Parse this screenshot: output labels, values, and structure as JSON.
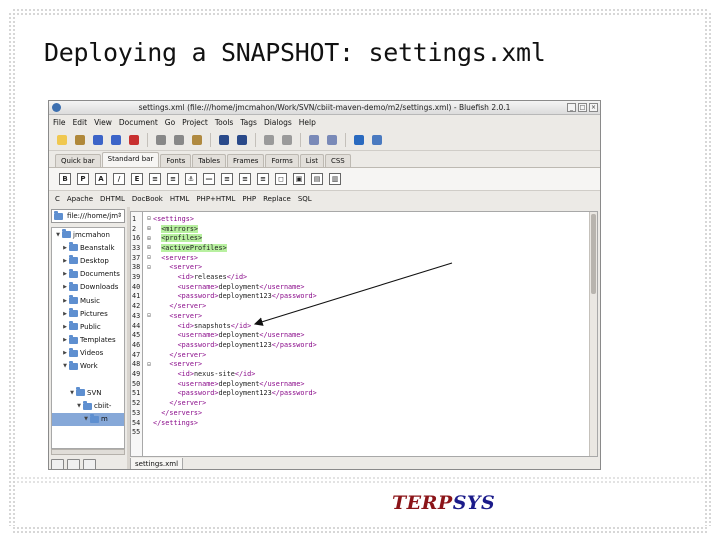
{
  "slide": {
    "title": "Deploying a SNAPSHOT: settings.xml",
    "logo_text_1": "TERP",
    "logo_text_2": "SYS"
  },
  "window": {
    "title": "settings.xml (file:///home/jmcmahon/Work/SVN/cbiit-maven-demo/m2/settings.xml) - Bluefish 2.0.1",
    "min_glyph": "_",
    "max_glyph": "□",
    "close_glyph": "×"
  },
  "menu": [
    "File",
    "Edit",
    "View",
    "Document",
    "Go",
    "Project",
    "Tools",
    "Tags",
    "Dialogs",
    "Help"
  ],
  "toolbar_icons": [
    "new-document",
    "open",
    "save",
    "save-as",
    "close",
    "cut",
    "copy",
    "paste",
    "find",
    "replace",
    "undo",
    "redo",
    "indent",
    "unindent",
    "preview",
    "settings"
  ],
  "tabs": [
    "Quick bar",
    "Standard bar",
    "Fonts",
    "Tables",
    "Frames",
    "Forms",
    "List",
    "CSS"
  ],
  "active_tab": "Standard bar",
  "standard_icons": [
    "B",
    "P",
    "A",
    "/",
    "E",
    "≡",
    "≡",
    "⚓",
    "—",
    "≡",
    "≡",
    "≡",
    "◻",
    "▣",
    "▤",
    "▥"
  ],
  "lang_menu": [
    "C",
    "Apache",
    "DHTML",
    "DocBook",
    "HTML",
    "PHP+HTML",
    "PHP",
    "Replace",
    "SQL"
  ],
  "sidebar": {
    "path": "file:///home/jm",
    "tree": [
      {
        "label": "jmcmahon",
        "level": 0,
        "twisty": "▼",
        "selected": false
      },
      {
        "label": "Beanstalk",
        "level": 1,
        "twisty": "▶",
        "selected": false
      },
      {
        "label": "Desktop",
        "level": 1,
        "twisty": "▶",
        "selected": false
      },
      {
        "label": "Documents",
        "level": 1,
        "twisty": "▶",
        "selected": false
      },
      {
        "label": "Downloads",
        "level": 1,
        "twisty": "▶",
        "selected": false
      },
      {
        "label": "Music",
        "level": 1,
        "twisty": "▶",
        "selected": false
      },
      {
        "label": "Pictures",
        "level": 1,
        "twisty": "▶",
        "selected": false
      },
      {
        "label": "Public",
        "level": 1,
        "twisty": "▶",
        "selected": false
      },
      {
        "label": "Templates",
        "level": 1,
        "twisty": "▶",
        "selected": false
      },
      {
        "label": "Videos",
        "level": 1,
        "twisty": "▶",
        "selected": false
      },
      {
        "label": "Work",
        "level": 1,
        "twisty": "▼",
        "selected": false
      },
      {
        "label": "",
        "level": 2,
        "twisty": "",
        "selected": false
      },
      {
        "label": "SVN",
        "level": 2,
        "twisty": "▼",
        "selected": false
      },
      {
        "label": "cbiit-",
        "level": 3,
        "twisty": "▼",
        "selected": false
      },
      {
        "label": "m",
        "level": 4,
        "twisty": "▼",
        "selected": true
      }
    ]
  },
  "editor": {
    "doc_tab": "settings.xml",
    "lines": [
      {
        "n": "1",
        "f": "⊟",
        "segs": [
          {
            "t": "<settings>",
            "c": "tag"
          }
        ]
      },
      {
        "n": "2",
        "f": "⊞",
        "segs": [
          {
            "t": "  "
          },
          {
            "t": "<mirrors>",
            "c": "hl"
          }
        ]
      },
      {
        "n": "16",
        "f": "⊞",
        "segs": [
          {
            "t": "  "
          },
          {
            "t": "<profiles>",
            "c": "hl"
          }
        ]
      },
      {
        "n": "33",
        "f": "⊞",
        "segs": [
          {
            "t": "  "
          },
          {
            "t": "<activeProfiles>",
            "c": "hl"
          }
        ]
      },
      {
        "n": "37",
        "f": "⊟",
        "segs": [
          {
            "t": "  "
          },
          {
            "t": "<servers>",
            "c": "tag"
          }
        ]
      },
      {
        "n": "38",
        "f": "⊟",
        "segs": [
          {
            "t": "    "
          },
          {
            "t": "<server>",
            "c": "tag"
          }
        ]
      },
      {
        "n": "39",
        "f": "",
        "segs": [
          {
            "t": "      "
          },
          {
            "t": "<id>",
            "c": "tag"
          },
          {
            "t": "releases"
          },
          {
            "t": "</id>",
            "c": "tag"
          }
        ]
      },
      {
        "n": "40",
        "f": "",
        "segs": [
          {
            "t": "      "
          },
          {
            "t": "<username>",
            "c": "tag"
          },
          {
            "t": "deployment"
          },
          {
            "t": "</username>",
            "c": "tag"
          }
        ]
      },
      {
        "n": "41",
        "f": "",
        "segs": [
          {
            "t": "      "
          },
          {
            "t": "<password>",
            "c": "tag"
          },
          {
            "t": "deployment123"
          },
          {
            "t": "</password>",
            "c": "tag"
          }
        ]
      },
      {
        "n": "42",
        "f": "",
        "segs": [
          {
            "t": "    "
          },
          {
            "t": "</server>",
            "c": "tag"
          }
        ]
      },
      {
        "n": "43",
        "f": "⊟",
        "segs": [
          {
            "t": "    "
          },
          {
            "t": "<server>",
            "c": "tag"
          }
        ]
      },
      {
        "n": "44",
        "f": "",
        "segs": [
          {
            "t": "      "
          },
          {
            "t": "<id>",
            "c": "tag"
          },
          {
            "t": "snapshots"
          },
          {
            "t": "</id>",
            "c": "tag"
          }
        ]
      },
      {
        "n": "45",
        "f": "",
        "segs": [
          {
            "t": "      "
          },
          {
            "t": "<username>",
            "c": "tag"
          },
          {
            "t": "deployment"
          },
          {
            "t": "</username>",
            "c": "tag"
          }
        ]
      },
      {
        "n": "46",
        "f": "",
        "segs": [
          {
            "t": "      "
          },
          {
            "t": "<password>",
            "c": "tag"
          },
          {
            "t": "deployment123"
          },
          {
            "t": "</password>",
            "c": "tag"
          }
        ]
      },
      {
        "n": "47",
        "f": "",
        "segs": [
          {
            "t": "    "
          },
          {
            "t": "</server>",
            "c": "tag"
          }
        ]
      },
      {
        "n": "48",
        "f": "⊟",
        "segs": [
          {
            "t": "    "
          },
          {
            "t": "<server>",
            "c": "tag"
          }
        ]
      },
      {
        "n": "49",
        "f": "",
        "segs": [
          {
            "t": "      "
          },
          {
            "t": "<id>",
            "c": "tag"
          },
          {
            "t": "nexus-site"
          },
          {
            "t": "</id>",
            "c": "tag"
          }
        ]
      },
      {
        "n": "50",
        "f": "",
        "segs": [
          {
            "t": "      "
          },
          {
            "t": "<username>",
            "c": "tag"
          },
          {
            "t": "deployment"
          },
          {
            "t": "</username>",
            "c": "tag"
          }
        ]
      },
      {
        "n": "51",
        "f": "",
        "segs": [
          {
            "t": "      "
          },
          {
            "t": "<password>",
            "c": "tag"
          },
          {
            "t": "deployment123"
          },
          {
            "t": "</password>",
            "c": "tag"
          }
        ]
      },
      {
        "n": "52",
        "f": "",
        "segs": [
          {
            "t": "    "
          },
          {
            "t": "</server>",
            "c": "tag"
          }
        ]
      },
      {
        "n": "53",
        "f": "",
        "segs": [
          {
            "t": "  "
          },
          {
            "t": "</servers>",
            "c": "tag"
          }
        ]
      },
      {
        "n": "54",
        "f": "",
        "segs": [
          {
            "t": "</settings>",
            "c": "tag"
          }
        ]
      },
      {
        "n": "55",
        "f": "",
        "segs": []
      }
    ]
  },
  "colors": {
    "tag": "#8a0a8a",
    "highlight": "#b8f0a0",
    "selection": "#86a8d8",
    "logo_red": "#8b1418",
    "logo_blue": "#1b1b8a"
  }
}
